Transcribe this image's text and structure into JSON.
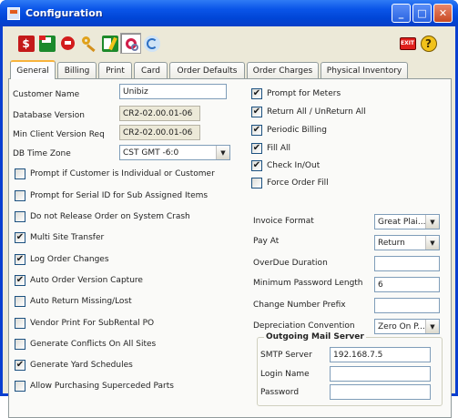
{
  "window": {
    "title": "Configuration"
  },
  "toolbar": {
    "left_icons": [
      "save-dollar-icon",
      "new-record-icon",
      "record-icon",
      "key-icon",
      "edit-icon",
      "settings-gear-icon",
      "refresh-icon"
    ],
    "right_icons": [
      "exit-icon",
      "help-icon"
    ]
  },
  "tabs": [
    "General",
    "Billing",
    "Print",
    "Card",
    "Order Defaults",
    "Order Charges",
    "Physical Inventory"
  ],
  "active_tab": "General",
  "left": {
    "customer_name_label": "Customer Name",
    "customer_name_value": "Unibiz",
    "db_version_label": "Database Version",
    "db_version_value": "CR2-02.00.01-06",
    "min_client_label": "Min Client Version Req",
    "min_client_value": "CR2-02.00.01-06",
    "timezone_label": "DB Time Zone",
    "timezone_value": "CST GMT -6:0"
  },
  "left_checks": [
    {
      "label": "Prompt if Customer is Individual or Customer",
      "checked": false
    },
    {
      "label": "Prompt for Serial ID for Sub Assigned Items",
      "checked": false
    },
    {
      "label": "Do not Release Order on System Crash",
      "checked": false
    },
    {
      "label": "Multi Site Transfer",
      "checked": true
    },
    {
      "label": "Log Order Changes",
      "checked": true
    },
    {
      "label": "Auto Order Version Capture",
      "checked": true
    },
    {
      "label": "Auto Return Missing/Lost",
      "checked": false
    },
    {
      "label": "Vendor Print For SubRental PO",
      "checked": false
    },
    {
      "label": "Generate Conflicts On All Sites",
      "checked": false
    },
    {
      "label": "Generate Yard Schedules",
      "checked": true
    },
    {
      "label": "Allow Purchasing Superceded Parts",
      "checked": false
    }
  ],
  "right_checks": [
    {
      "label": "Prompt for Meters",
      "checked": true
    },
    {
      "label": "Return All / UnReturn All",
      "checked": true
    },
    {
      "label": "Periodic Billing",
      "checked": true
    },
    {
      "label": "Fill All",
      "checked": true
    },
    {
      "label": "Check In/Out",
      "checked": true
    },
    {
      "label": "Force Order Fill",
      "checked": false
    }
  ],
  "right": {
    "invoice_format_label": "Invoice Format",
    "invoice_format_value": "Great Plai...",
    "pay_at_label": "Pay At",
    "pay_at_value": "Return",
    "overdue_label": "OverDue Duration",
    "overdue_value": "",
    "min_pwd_label": "Minimum Password Length",
    "min_pwd_value": "6",
    "change_prefix_label": "Change Number Prefix",
    "change_prefix_value": "",
    "depreciation_label": "Depreciation Convention",
    "depreciation_value": "Zero On P..."
  },
  "mail": {
    "title": "Outgoing Mail Server",
    "smtp_label": "SMTP Server",
    "smtp_value": "192.168.7.5",
    "login_label": "Login Name",
    "login_value": "",
    "password_label": "Password",
    "password_value": ""
  }
}
